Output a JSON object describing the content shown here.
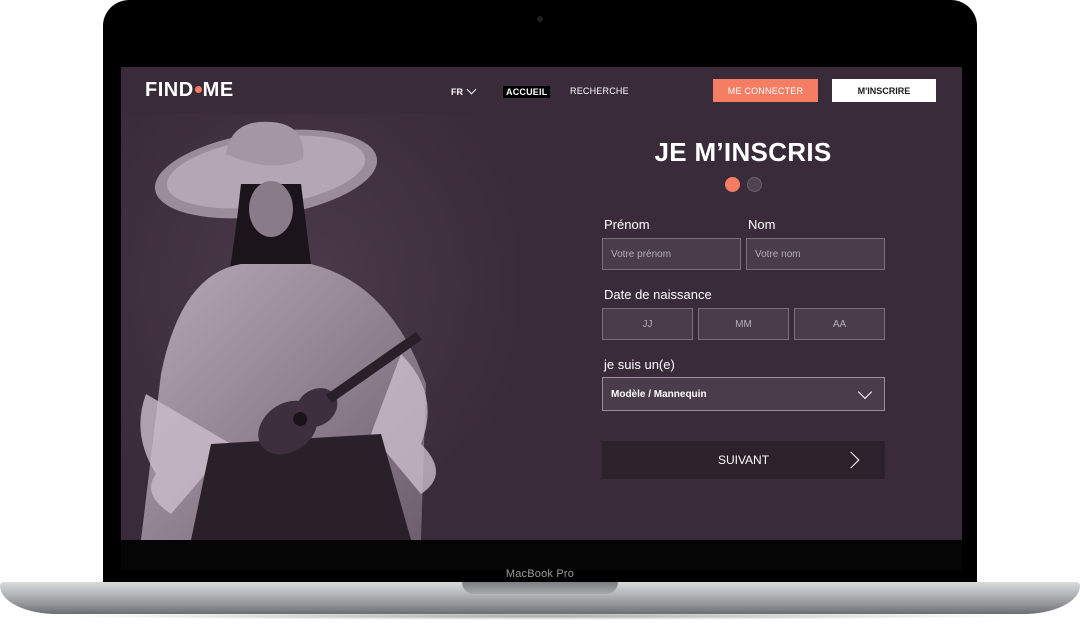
{
  "device": {
    "label": "MacBook Pro"
  },
  "nav": {
    "logo_left": "FIND",
    "logo_right": "ME",
    "language": "FR",
    "links": [
      "ACCUEIL",
      "RECHERCHE"
    ],
    "login_label": "ME CONNECTER",
    "signup_label": "M'INSCRIRE"
  },
  "form": {
    "title": "JE M’INSCRIS",
    "steps": {
      "current": 1,
      "total": 2
    },
    "first_name_label": "Prénom",
    "first_name_placeholder": "Votre prénom",
    "last_name_label": "Nom",
    "last_name_placeholder": "Votre nom",
    "birthdate_label": "Date de naissance",
    "day_placeholder": "JJ",
    "month_placeholder": "MM",
    "year_placeholder": "AA",
    "role_label": "je suis un(e)",
    "role_selected": "Modèle / Mannequin",
    "next_label": "SUIVANT"
  },
  "colors": {
    "accent": "#f47d64",
    "background": "#3a2b3a",
    "button_dark": "#2c222c"
  }
}
